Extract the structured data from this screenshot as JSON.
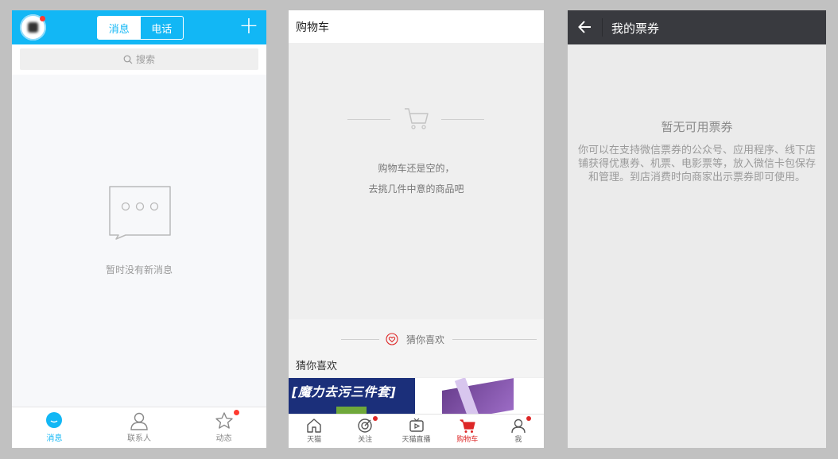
{
  "qq": {
    "tabs": {
      "messages": "消息",
      "phone": "电话"
    },
    "plus_icon": "plus-icon",
    "search_placeholder": "搜索",
    "empty_text": "暂时没有新消息",
    "bottom_tabs": [
      {
        "label": "消息",
        "icon": "chat-bubble-icon",
        "active": true
      },
      {
        "label": "联系人",
        "icon": "person-icon",
        "active": false
      },
      {
        "label": "动态",
        "icon": "star-icon",
        "active": false,
        "badge": true
      }
    ],
    "accent_color": "#12b7f5"
  },
  "tmall": {
    "title": "购物车",
    "empty_line1": "购物车还是空的，",
    "empty_line2": "去挑几件中意的商品吧",
    "guess_label": "猜你喜欢",
    "guess_title": "猜你喜欢",
    "ad_text": "[魔力去污三件套]",
    "bottom_tabs": [
      {
        "label": "天猫",
        "icon": "home-icon",
        "active": false
      },
      {
        "label": "关注",
        "icon": "target-icon",
        "active": false,
        "badge": true
      },
      {
        "label": "天猫直播",
        "icon": "tv-icon",
        "active": false
      },
      {
        "label": "购物车",
        "icon": "cart-icon",
        "active": true
      },
      {
        "label": "我",
        "icon": "person-icon",
        "active": false,
        "badge": true
      }
    ],
    "accent_color": "#dd2727"
  },
  "wechat": {
    "title": "我的票券",
    "empty_title": "暂无可用票券",
    "empty_desc": "你可以在支持微信票券的公众号、应用程序、线下店铺获得优惠券、机票、电影票等，放入微信卡包保存和管理。到店消费时向商家出示票券即可使用。"
  }
}
